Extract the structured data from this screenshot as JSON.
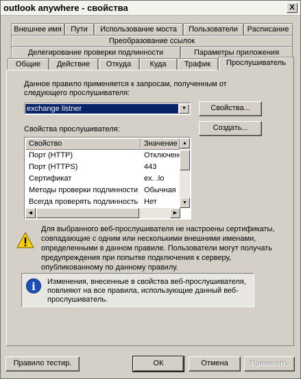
{
  "window": {
    "title": "outlook anywhere - свойства",
    "close_label": "X"
  },
  "tabs": {
    "row1": [
      "Внешнее имя",
      "Пути",
      "Использование моста",
      "Пользователи",
      "Расписание"
    ],
    "row2": [
      "Преобразование ссылок"
    ],
    "row3": [
      "Делегирование проверки подлинности",
      "Параметры приложения"
    ],
    "row4": [
      "Общие",
      "Действие",
      "Откуда",
      "Куда",
      "Трафик",
      "Прослушиватель"
    ],
    "active": "Прослушиватель"
  },
  "listener": {
    "description": "Данное правило применяется к запросам, полученным от следующего прослушивателя:",
    "selected": "exchange listner",
    "properties_button": "Свойства...",
    "create_button": "Создать...",
    "props_label": "Свойства прослушивателя:",
    "columns": [
      "Свойство",
      "Значение"
    ],
    "rows": [
      [
        "Порт (HTTP)",
        "Отключено"
      ],
      [
        "Порт (HTTPS)",
        "443"
      ],
      [
        "Сертификат",
        "ex.          .lo"
      ],
      [
        "Методы проверки подлинности",
        "Обычная"
      ],
      [
        "Всегда проверять подлинность",
        "Нет"
      ]
    ]
  },
  "warning_text": "Для выбранного веб-прослушивателя не настроены сертификаты, совпадающие с одним или несколькими внешними именами, определенными в данном правиле. Пользователи могут получать предупреждения при попытке подключения к серверу, опубликованному по данному правилу.",
  "info_text": "Изменения, внесенные в свойства веб-прослушивателя, повлияют на все правила, использующие данный веб-прослушиватель.",
  "buttons": {
    "test": "Правило тестир.",
    "ok": "ОК",
    "cancel": "Отмена",
    "apply": "Применить"
  },
  "icons": {
    "warning": "warning-icon",
    "info": "info-icon"
  }
}
